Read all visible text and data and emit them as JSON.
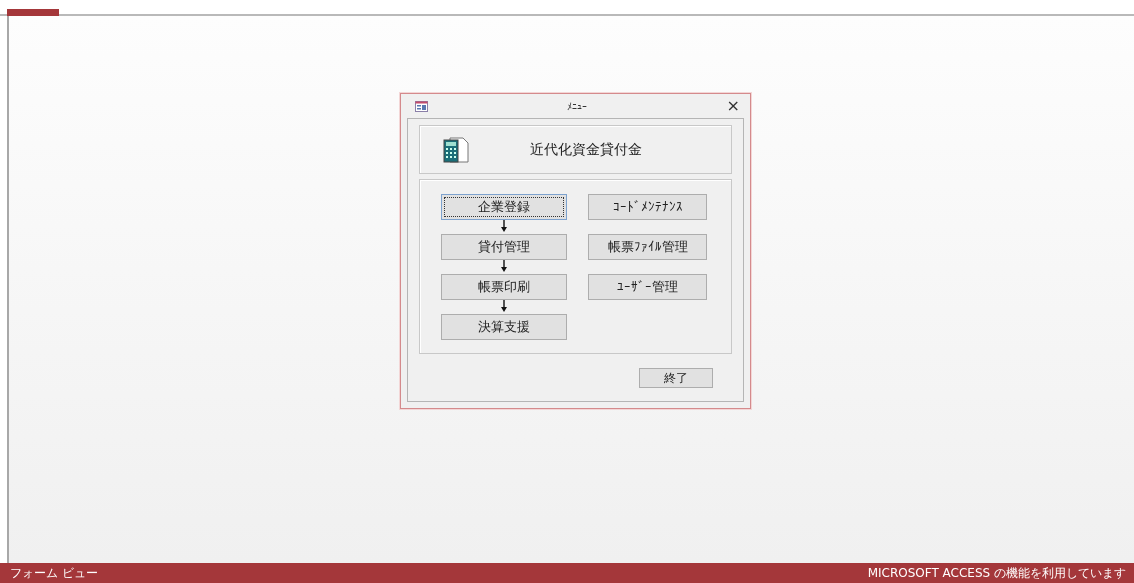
{
  "dialog": {
    "title": "ﾒﾆｭｰ",
    "close": "×",
    "heading": "近代化資金貸付金",
    "left_buttons": [
      {
        "label": "企業登録",
        "focused": true
      },
      {
        "label": "貸付管理",
        "focused": false
      },
      {
        "label": "帳票印刷",
        "focused": false
      },
      {
        "label": "決算支援",
        "focused": false
      }
    ],
    "right_buttons": [
      {
        "label": "ｺｰﾄﾞﾒﾝﾃﾅﾝｽ",
        "focused": false
      },
      {
        "label": "帳票ﾌｧｲﾙ管理",
        "focused": false
      },
      {
        "label": "ﾕｰｻﾞｰ管理",
        "focused": false
      }
    ],
    "exit_button": "終了"
  },
  "status_bar": {
    "left": "フォーム ビュー",
    "right": "MICROSOFT ACCESS の機能を利用しています"
  }
}
